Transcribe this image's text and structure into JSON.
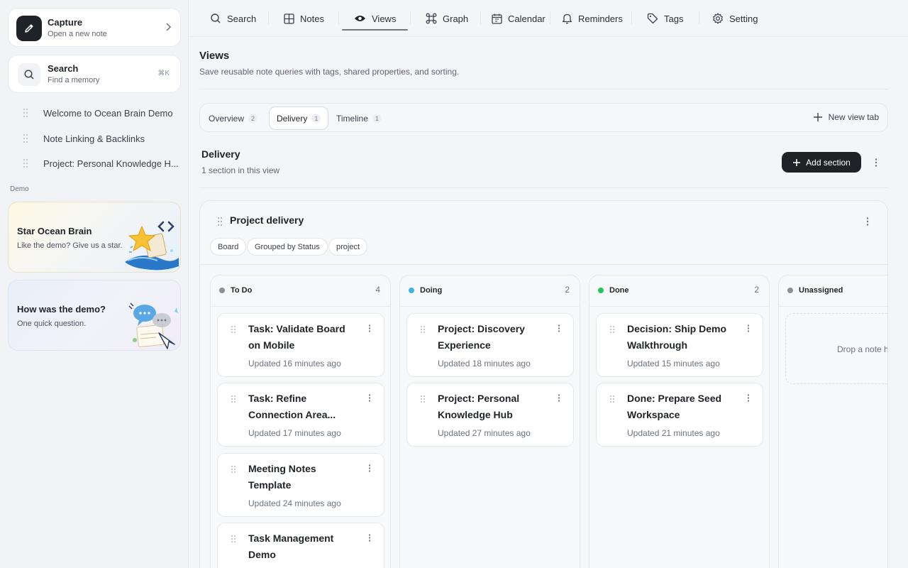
{
  "sidebar": {
    "capture": {
      "title": "Capture",
      "subtitle": "Open a new note"
    },
    "search": {
      "title": "Search",
      "subtitle": "Find a memory",
      "shortcut": "⌘K"
    },
    "recent": [
      "Welcome to Ocean Brain Demo",
      "Note Linking & Backlinks",
      "Project: Personal Knowledge H..."
    ],
    "demo_label": "Demo",
    "promos": [
      {
        "title": "Star Ocean Brain",
        "subtitle": "Like the demo? Give us a star."
      },
      {
        "title": "How was the demo?",
        "subtitle": "One quick question."
      }
    ]
  },
  "nav": {
    "items": [
      "Search",
      "Notes",
      "Views",
      "Graph",
      "Calendar",
      "Reminders",
      "Tags",
      "Setting"
    ],
    "active": "Views"
  },
  "views": {
    "title": "Views",
    "subtitle": "Save reusable note queries with tags, shared properties, and sorting.",
    "tabs": [
      {
        "label": "Overview",
        "count": "2"
      },
      {
        "label": "Delivery",
        "count": "1"
      },
      {
        "label": "Timeline",
        "count": "1"
      }
    ],
    "new_tab_label": "New view tab",
    "section_title": "Delivery",
    "section_subtitle": "1 section in this view",
    "add_section_label": "Add section"
  },
  "board": {
    "title": "Project delivery",
    "chips": [
      "Board",
      "Grouped by Status",
      "project"
    ],
    "columns": [
      {
        "name": "To Do",
        "count": "4",
        "color": "#8b9099",
        "cards": [
          {
            "title": "Task: Validate Board on Mobile",
            "updated": "Updated 16 minutes ago"
          },
          {
            "title": "Task: Refine Connection Area...",
            "updated": "Updated 17 minutes ago"
          },
          {
            "title": "Meeting Notes Template",
            "updated": "Updated 24 minutes ago"
          },
          {
            "title": "Task Management Demo",
            "updated": ""
          }
        ]
      },
      {
        "name": "Doing",
        "count": "2",
        "color": "#3fb3e8",
        "cards": [
          {
            "title": "Project: Discovery Experience",
            "updated": "Updated 18 minutes ago"
          },
          {
            "title": "Project: Personal Knowledge Hub",
            "updated": "Updated 27 minutes ago"
          }
        ]
      },
      {
        "name": "Done",
        "count": "2",
        "color": "#22c55e",
        "cards": [
          {
            "title": "Decision: Ship Demo Walkthrough",
            "updated": "Updated 15 minutes ago"
          },
          {
            "title": "Done: Prepare Seed Workspace",
            "updated": "Updated 21 minutes ago"
          }
        ]
      },
      {
        "name": "Unassigned",
        "count": "",
        "color": "#8b9099",
        "empty_text": "Drop a note here",
        "cards": []
      }
    ]
  }
}
